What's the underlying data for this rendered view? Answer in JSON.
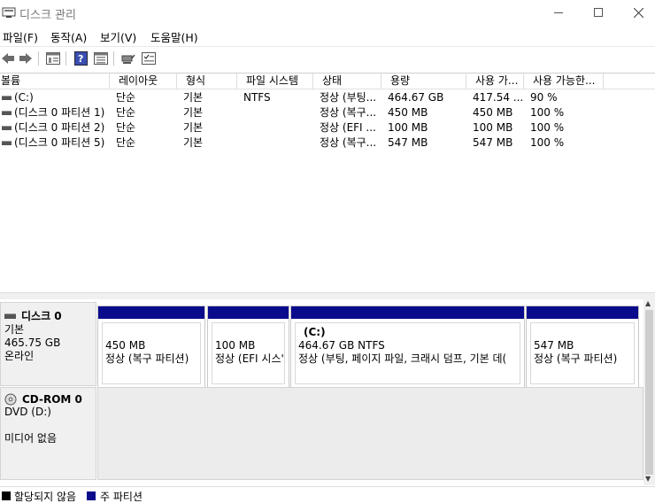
{
  "window": {
    "title": "디스크 관리"
  },
  "menu": [
    "파일(F)",
    "동작(A)",
    "보기(V)",
    "도움말(H)"
  ],
  "toolbar": {
    "icons": [
      "back-arrow-icon",
      "forward-arrow-icon",
      "properties-pane-icon",
      "help-icon",
      "layout-pane-icon",
      "connect-icon",
      "checklist-icon"
    ]
  },
  "volume_list": {
    "columns": [
      "볼륨",
      "레이아웃",
      "형식",
      "파일 시스템",
      "상태",
      "용량",
      "사용 가...",
      "사용 가능한..."
    ],
    "rows": [
      [
        "(C:)",
        "단순",
        "기본",
        "NTFS",
        "정상 (부팅...",
        "464.67 GB",
        "417.54 ...",
        "90 %"
      ],
      [
        "(디스크 0 파티션 1)",
        "단순",
        "기본",
        "",
        "정상 (복구...",
        "450 MB",
        "450 MB",
        "100 %"
      ],
      [
        "(디스크 0 파티션 2)",
        "단순",
        "기본",
        "",
        "정상 (EFI ...",
        "100 MB",
        "100 MB",
        "100 %"
      ],
      [
        "(디스크 0 파티션 5)",
        "단순",
        "기본",
        "",
        "정상 (복구...",
        "547 MB",
        "547 MB",
        "100 %"
      ]
    ]
  },
  "disks": [
    {
      "name": "디스크 0",
      "type": "기본",
      "size": "465.75 GB",
      "status": "온라인",
      "partitions": [
        {
          "title": "",
          "size": "450 MB",
          "status": "정상 (복구 파티션)"
        },
        {
          "title": "",
          "size": "100 MB",
          "status": "정상 (EFI 시스'"
        },
        {
          "title": "(C:)",
          "size": "464.67 GB NTFS",
          "status": "정상 (부팅, 페이지 파일, 크래시 덤프, 기본 데("
        },
        {
          "title": "",
          "size": "547 MB",
          "status": "정상 (복구 파티션)"
        }
      ]
    },
    {
      "name": "CD-ROM 0",
      "type": "DVD (D:)",
      "size": "",
      "status": "미디어 없음"
    }
  ],
  "legend": [
    {
      "label": "할당되지 않음",
      "color": "#000000"
    },
    {
      "label": "주 파티션",
      "color": "#0a0a8c"
    }
  ],
  "colors": {
    "primary_partition": "#0a0a8c",
    "unallocated": "#000000"
  }
}
